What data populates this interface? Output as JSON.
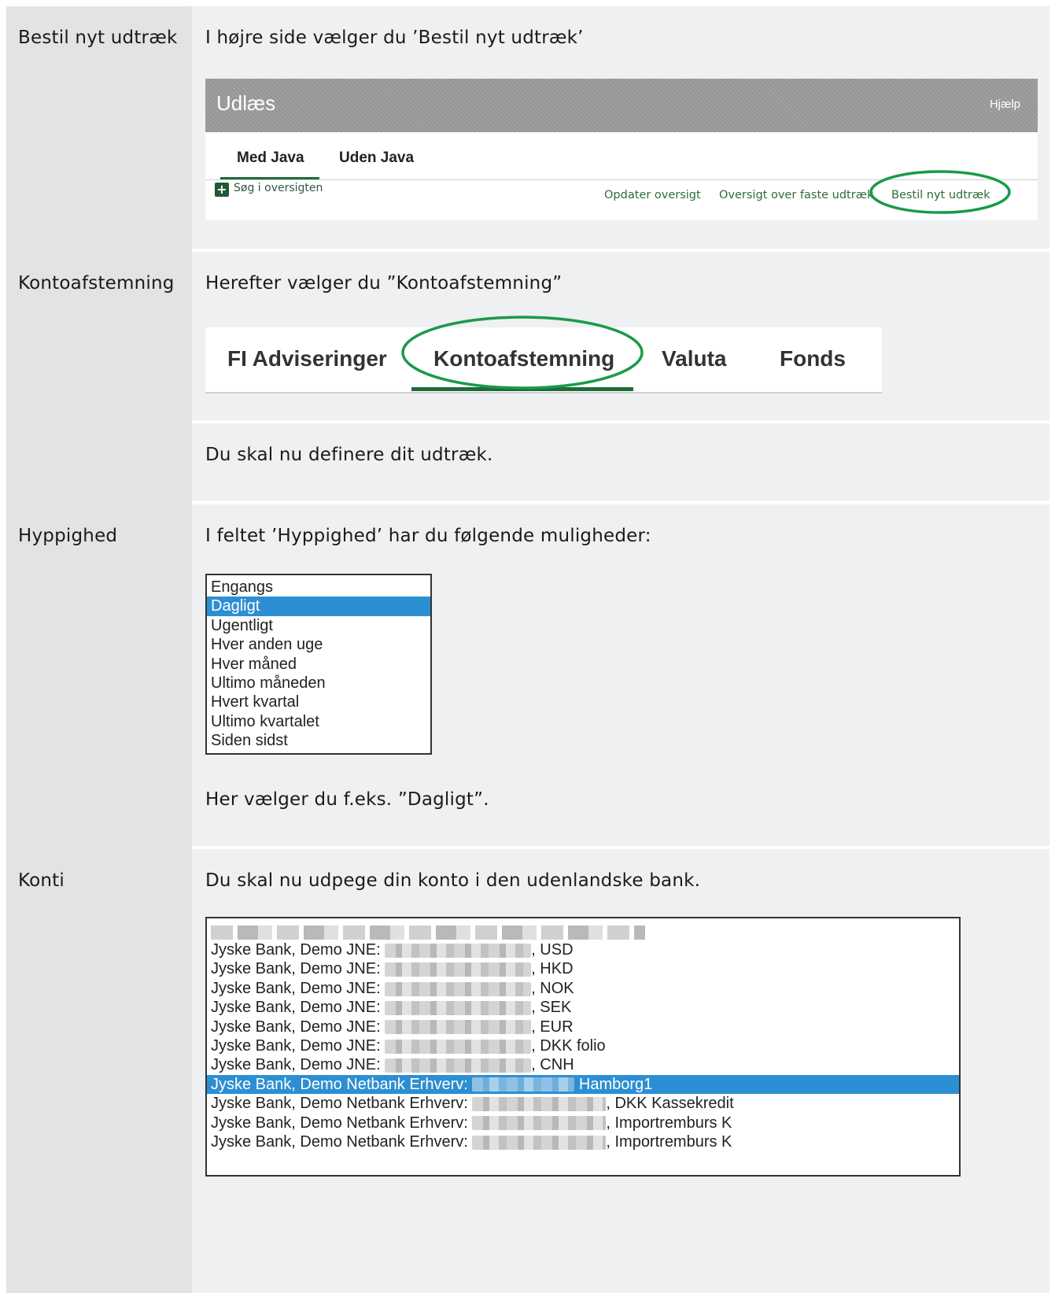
{
  "rows": {
    "bestil": {
      "label": "Bestil nyt udtræk",
      "text": "I højre side vælger du ’Bestil nyt udtræk’",
      "panel": {
        "title": "Udlæs",
        "help": "Hjælp",
        "tabs": [
          "Med Java",
          "Uden Java"
        ],
        "search": "Søg i oversigten",
        "links": [
          "Opdater oversigt",
          "Oversigt over faste udtræk",
          "Bestil nyt udtræk"
        ]
      }
    },
    "konto": {
      "label": "Kontoafstemning",
      "text": "Herefter vælger du ”Kontoafstemning”",
      "tabs": [
        "FI Adviseringer",
        "Kontoafstemning",
        "Valuta",
        "Fonds"
      ]
    },
    "define": {
      "text": "Du skal nu definere dit udtræk."
    },
    "hyppighed": {
      "label": "Hyppighed",
      "text": "I feltet ’Hyppighed’ har du følgende muligheder:",
      "options": [
        "Engangs",
        "Dagligt",
        "Ugentligt",
        "Hver anden uge",
        "Hver måned",
        "Ultimo måneden",
        "Hvert kvartal",
        "Ultimo kvartalet",
        "Siden sidst"
      ],
      "selected": "Dagligt",
      "note": "Her vælger du f.eks. ”Dagligt”."
    },
    "konti": {
      "label": "Konti",
      "text": "Du skal nu udpege din konto i den udenlandske bank.",
      "accounts": [
        {
          "prefix": "Jyske Bank, Demo JNE: ",
          "suffix": ", USD"
        },
        {
          "prefix": "Jyske Bank, Demo JNE: ",
          "suffix": ", HKD"
        },
        {
          "prefix": "Jyske Bank, Demo JNE: ",
          "suffix": ", NOK"
        },
        {
          "prefix": "Jyske Bank, Demo JNE: ",
          "suffix": ", SEK"
        },
        {
          "prefix": "Jyske Bank, Demo JNE: ",
          "suffix": ", EUR"
        },
        {
          "prefix": "Jyske Bank, Demo JNE: ",
          "suffix": ", DKK folio"
        },
        {
          "prefix": "Jyske Bank, Demo JNE: ",
          "suffix": ", CNH"
        },
        {
          "prefix": "Jyske Bank, Demo Netbank Erhverv: ",
          "suffix": " Hamborg1"
        },
        {
          "prefix": "Jyske Bank, Demo Netbank Erhverv: ",
          "suffix": ", DKK Kassekredit"
        },
        {
          "prefix": "Jyske Bank, Demo Netbank Erhverv: ",
          "suffix": ", Importremburs K"
        },
        {
          "prefix": "Jyske Bank, Demo Netbank Erhverv: ",
          "suffix": ", Importremburs K"
        }
      ],
      "selected_index": 7
    }
  },
  "colors": {
    "left_column": "#e1e3e4",
    "content_bg": "#eff0f1",
    "highlight_circle": "#1a9a4a",
    "selection": "#2d8fd3",
    "tab_underline": "#1f6b3a"
  }
}
